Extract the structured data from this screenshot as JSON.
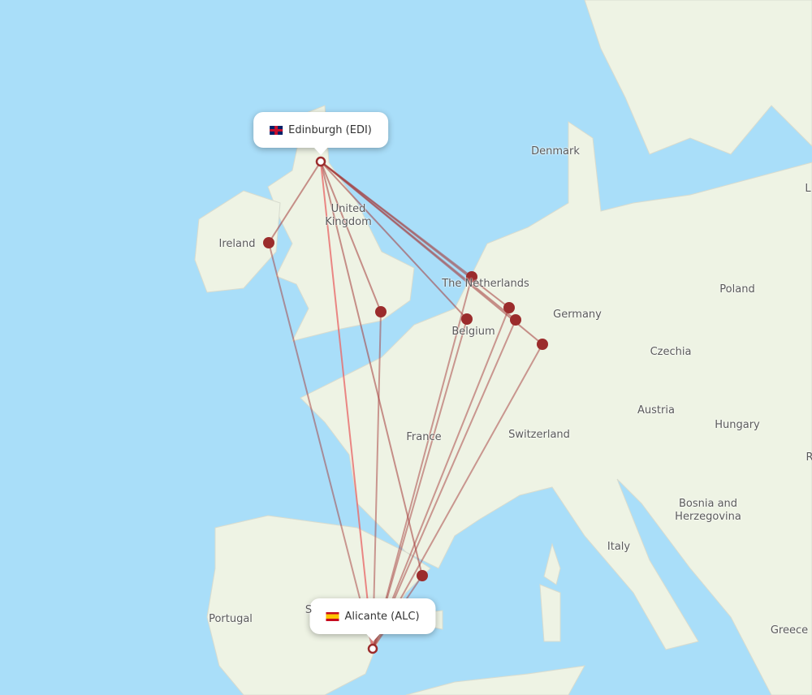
{
  "colors": {
    "sea": "#a9def9",
    "land": "#eef3e4",
    "route": "#a43a3a",
    "route_direct": "#e86a6a",
    "marker": "#9b2c2c"
  },
  "origin": {
    "name": "Edinburgh (EDI)",
    "flag": "uk-flag-icon"
  },
  "destination": {
    "name": "Alicante (ALC)",
    "flag": "spain-flag-icon"
  },
  "labels": [
    "Denmark",
    "United Kingdom",
    "Ireland",
    "The Netherlands",
    "Belgium",
    "Germany",
    "Poland",
    "Czechia",
    "Austria",
    "Hungary",
    "Switzerland",
    "France",
    "Bosnia and Herzegovina",
    "Italy",
    "Portugal",
    "Greece",
    "S",
    "L",
    "R"
  ]
}
